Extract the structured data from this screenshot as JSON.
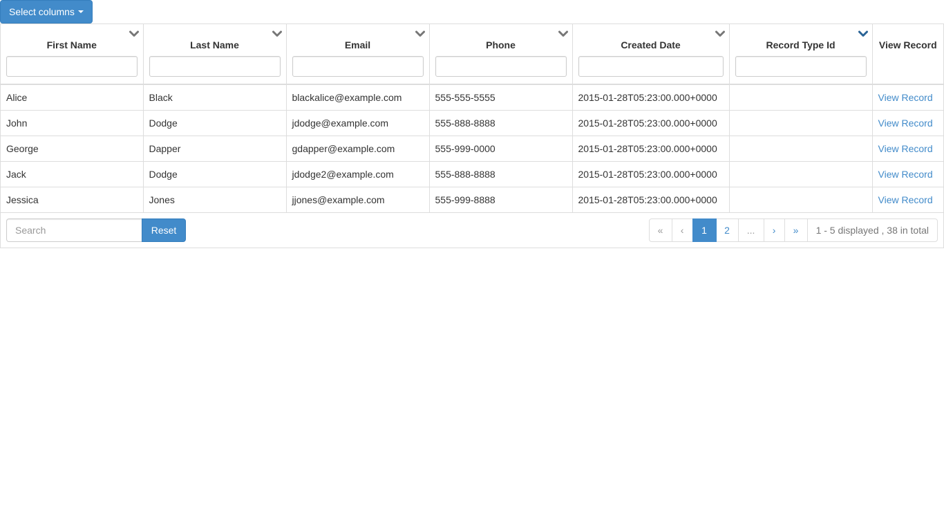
{
  "toolbar": {
    "select_columns_label": "Select columns"
  },
  "columns": [
    {
      "label": "First Name",
      "sortable": true,
      "filter_value": ""
    },
    {
      "label": "Last Name",
      "sortable": true,
      "filter_value": ""
    },
    {
      "label": "Email",
      "sortable": true,
      "filter_value": ""
    },
    {
      "label": "Phone",
      "sortable": true,
      "filter_value": ""
    },
    {
      "label": "Created Date",
      "sortable": true,
      "filter_value": ""
    },
    {
      "label": "Record Type Id",
      "sortable": true,
      "filter_value": "",
      "sort_active": true
    },
    {
      "label": "View Record",
      "sortable": false
    }
  ],
  "rows": [
    {
      "first": "Alice",
      "last": "Black",
      "email": "blackalice@example.com",
      "phone": "555-555-5555",
      "created": "2015-01-28T05:23:00.000+0000",
      "record_type": "",
      "link": "View Record"
    },
    {
      "first": "John",
      "last": "Dodge",
      "email": "jdodge@example.com",
      "phone": "555-888-8888",
      "created": "2015-01-28T05:23:00.000+0000",
      "record_type": "",
      "link": "View Record"
    },
    {
      "first": "George",
      "last": "Dapper",
      "email": "gdapper@example.com",
      "phone": "555-999-0000",
      "created": "2015-01-28T05:23:00.000+0000",
      "record_type": "",
      "link": "View Record"
    },
    {
      "first": "Jack",
      "last": "Dodge",
      "email": "jdodge2@example.com",
      "phone": "555-888-8888",
      "created": "2015-01-28T05:23:00.000+0000",
      "record_type": "",
      "link": "View Record"
    },
    {
      "first": "Jessica",
      "last": "Jones",
      "email": "jjones@example.com",
      "phone": "555-999-8888",
      "created": "2015-01-28T05:23:00.000+0000",
      "record_type": "",
      "link": "View Record"
    }
  ],
  "footer": {
    "search_placeholder": "Search",
    "search_value": "",
    "reset_label": "Reset",
    "pagination": {
      "first": "«",
      "prev": "‹",
      "pages": [
        "1",
        "2",
        "..."
      ],
      "active_page": "1",
      "next": "›",
      "last": "»",
      "info": "1 - 5 displayed , 38 in total"
    }
  },
  "colors": {
    "primary": "#428bca",
    "border": "#dddddd",
    "sort_icon": "#777777",
    "sort_icon_active": "#2a6496"
  },
  "icons": {
    "sort": "chevron-down-icon",
    "caret": "caret-down-icon"
  }
}
